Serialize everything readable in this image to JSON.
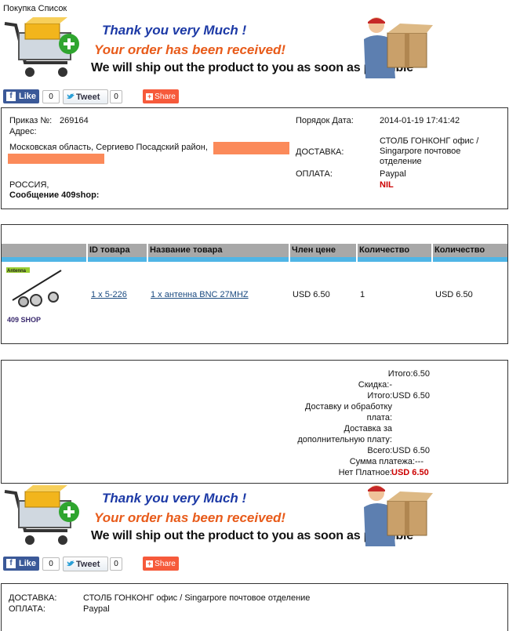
{
  "page": {
    "title": "Покупка Список"
  },
  "banner": {
    "thanks": "Thank you very Much !",
    "received": "Your order has been received!",
    "ship": "We will ship out the product to you as soon as possible"
  },
  "social": {
    "like_label": "Like",
    "like_count": "0",
    "tweet_label": "Tweet",
    "tweet_count": "0",
    "share_label": "Share"
  },
  "order": {
    "number_label": "Приказ №:",
    "number": "269164",
    "address_label": "Адрес:",
    "address_line": "Московская область, Сергиево Посадский район,",
    "country": "РОССИЯ,",
    "message_label": "Сообщение 409shop:",
    "date_label": "Порядок Дата:",
    "date": "2014-01-19 17:41:42",
    "shipping_label": "ДОСТАВКА:",
    "shipping_value": "СТОЛБ ГОНКОНГ офис / Singarpore почтовое отделение",
    "payment_label": "ОПЛАТА:",
    "payment_value": "Paypal",
    "payment_status": "NIL"
  },
  "items_table": {
    "headers": [
      "ID товара",
      "Название товара",
      "Член цене",
      "Количество",
      "Количество"
    ],
    "rows": [
      {
        "image_logo": "409 SHOP",
        "image_text": "Antenna",
        "id": "1 x 5-226",
        "name": "1 x антенна BNC 27MHZ",
        "price": "USD 6.50",
        "qty": "1",
        "total": "USD 6.50"
      }
    ]
  },
  "totals": {
    "subtotal": "Итого:6.50",
    "discount": "Скидка:-",
    "total": "Итого:USD 6.50",
    "handling_line1": "Доставку и обработку",
    "handling_line2": "плата:",
    "extra_line1": "Доставка за",
    "extra_line2": "дополнительную плату:",
    "grand": "Всего:USD 6.50",
    "payment_sum": "Сумма платежа:---",
    "unpaid_label": "Нет Платное:",
    "unpaid_value": "USD 6.50"
  },
  "footer": {
    "shipping_label": "ДОСТАВКА:",
    "shipping_value": "СТОЛБ ГОНКОНГ офис / Singarpore почтовое отделение",
    "payment_label": "ОПЛАТА:",
    "payment_value": "Paypal"
  },
  "colors": {
    "accent_blue": "#1d3aa6",
    "accent_orange": "#e85b1a",
    "table_stripe": "#4fb5e6",
    "table_header": "#a8a8a8",
    "alert_red": "#cc0000",
    "redacted": "#fb8a5a"
  }
}
